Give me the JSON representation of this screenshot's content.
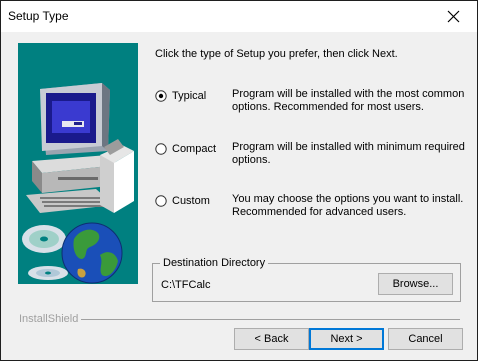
{
  "window": {
    "title": "Setup Type"
  },
  "intro_text": "Click the type of Setup you prefer, then click Next.",
  "options": [
    {
      "label": "Typical",
      "description_line1": "Program will be installed with the most common",
      "description_line2": "options.  Recommended for most users.",
      "selected": true
    },
    {
      "label": "Compact",
      "description_line1": "Program will be installed with minimum required",
      "description_line2": "options.",
      "selected": false
    },
    {
      "label": "Custom",
      "description_line1": "You may choose the options you want to install.",
      "description_line2": "Recommended for advanced users.",
      "selected": false
    }
  ],
  "destination": {
    "group_label": "Destination Directory",
    "path": "C:\\TFCalc",
    "browse_label": "Browse..."
  },
  "brand": "InstallShield",
  "buttons": {
    "back": "< Back",
    "next": "Next >",
    "cancel": "Cancel"
  },
  "colors": {
    "art_background": "#008080",
    "dialog_background": "#f0f0f0",
    "default_button_border": "#0078d7"
  },
  "icons": {
    "close": "close-icon",
    "art": "computer-globe-cds-illustration"
  }
}
